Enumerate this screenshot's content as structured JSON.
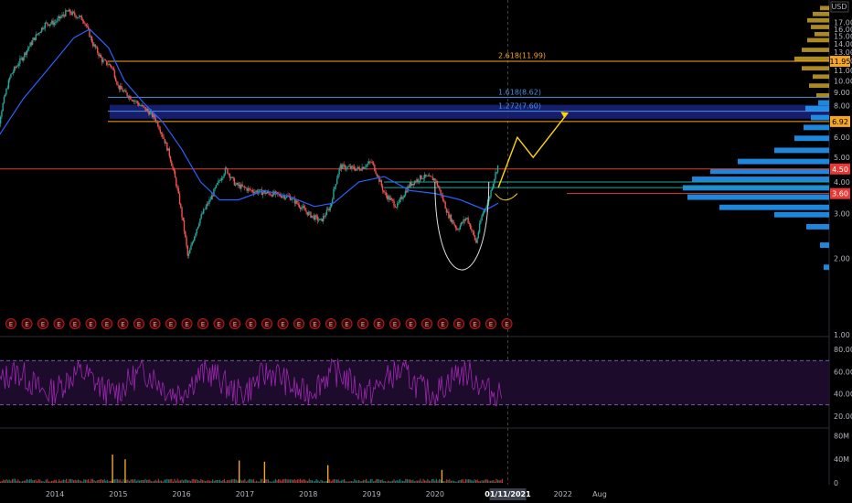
{
  "chart_data": {
    "type": "candlestick",
    "currency": "USD",
    "price_axis": {
      "scale": "log",
      "ticks": [
        "17.00",
        "16.00",
        "15.00",
        "14.00",
        "13.00",
        "12.00",
        "11.00",
        "10.00",
        "9.00",
        "8.00",
        "7.00",
        "6.00",
        "5.00",
        "4.00",
        "3.00",
        "2.00",
        "1.00"
      ]
    },
    "time_axis": {
      "labels": [
        "2014",
        "2015",
        "2016",
        "2017",
        "2018",
        "2019",
        "2020",
        "2021",
        "2022",
        "Aug"
      ],
      "highlight": "01/11/2021"
    },
    "price_series": [
      [
        2013.0,
        4.0
      ],
      [
        2013.15,
        7.5
      ],
      [
        2013.3,
        10.5
      ],
      [
        2013.5,
        12.5
      ],
      [
        2013.7,
        15.0
      ],
      [
        2013.85,
        16.8
      ],
      [
        2014.0,
        17.0
      ],
      [
        2014.2,
        18.8
      ],
      [
        2014.45,
        17.5
      ],
      [
        2014.6,
        14.0
      ],
      [
        2014.75,
        12.0
      ],
      [
        2014.9,
        11.4
      ],
      [
        2015.0,
        9.5
      ],
      [
        2015.1,
        9.0
      ],
      [
        2015.2,
        8.6
      ],
      [
        2015.35,
        8.0
      ],
      [
        2015.5,
        7.5
      ],
      [
        2015.6,
        7.0
      ],
      [
        2015.8,
        5.2
      ],
      [
        2016.0,
        3.0
      ],
      [
        2016.1,
        2.0
      ],
      [
        2016.3,
        2.9
      ],
      [
        2016.45,
        3.4
      ],
      [
        2016.7,
        4.5
      ],
      [
        2016.85,
        3.9
      ],
      [
        2017.1,
        3.7
      ],
      [
        2017.4,
        3.6
      ],
      [
        2017.7,
        3.5
      ],
      [
        2018.0,
        3.0
      ],
      [
        2018.2,
        2.8
      ],
      [
        2018.35,
        3.2
      ],
      [
        2018.5,
        4.6
      ],
      [
        2018.8,
        4.5
      ],
      [
        2019.0,
        4.8
      ],
      [
        2019.2,
        3.6
      ],
      [
        2019.4,
        3.2
      ],
      [
        2019.6,
        3.9
      ],
      [
        2019.8,
        4.2
      ],
      [
        2020.0,
        4.1
      ],
      [
        2020.2,
        3.0
      ],
      [
        2020.35,
        2.6
      ],
      [
        2020.5,
        2.9
      ],
      [
        2020.65,
        2.3
      ],
      [
        2020.75,
        3.0
      ],
      [
        2020.85,
        3.4
      ],
      [
        2021.0,
        4.7
      ]
    ],
    "moving_average": [
      [
        2013.0,
        5.5
      ],
      [
        2013.5,
        8.5
      ],
      [
        2014.0,
        12.0
      ],
      [
        2014.3,
        14.8
      ],
      [
        2014.55,
        16.0
      ],
      [
        2014.85,
        13.5
      ],
      [
        2015.1,
        10.0
      ],
      [
        2015.4,
        8.2
      ],
      [
        2015.7,
        6.9
      ],
      [
        2016.0,
        5.4
      ],
      [
        2016.3,
        4.0
      ],
      [
        2016.6,
        3.4
      ],
      [
        2016.9,
        3.4
      ],
      [
        2017.3,
        3.7
      ],
      [
        2017.7,
        3.5
      ],
      [
        2018.1,
        3.2
      ],
      [
        2018.4,
        3.3
      ],
      [
        2018.8,
        4.0
      ],
      [
        2019.2,
        4.2
      ],
      [
        2019.6,
        3.7
      ],
      [
        2020.0,
        3.6
      ],
      [
        2020.4,
        3.4
      ],
      [
        2020.8,
        3.1
      ],
      [
        2021.0,
        3.3
      ]
    ],
    "projection": [
      [
        2021.0,
        3.8
      ],
      [
        2021.3,
        6.0
      ],
      [
        2021.55,
        5.0
      ],
      [
        2022.1,
        7.5
      ]
    ],
    "rsi": {
      "ticks": [
        "80.00",
        "60.00",
        "40.00",
        "20.00"
      ],
      "overbought": 70,
      "oversold": 30
    },
    "volume": {
      "ticks": [
        "80M",
        "40M",
        "0"
      ],
      "spikes": [
        [
          2014.9,
          48
        ],
        [
          2015.1,
          40
        ],
        [
          2016.9,
          38
        ],
        [
          2017.3,
          36
        ],
        [
          2018.3,
          30
        ],
        [
          2020.1,
          22
        ]
      ]
    },
    "annotations": [
      {
        "label": "2.618(11.99)",
        "price": 11.99,
        "color": "#f5a623"
      },
      {
        "label": "1.618(8.62)",
        "price": 8.62,
        "color": "#4a90e2"
      },
      {
        "label": "1.272(7.60)",
        "price": 7.6,
        "color": "#4a90e2"
      }
    ],
    "price_tags": [
      {
        "label": "11.95",
        "price": 11.95,
        "bg": "#f5a623",
        "fg": "#000000"
      },
      {
        "label": "6.92",
        "price": 6.92,
        "bg": "#f5a623",
        "fg": "#000000"
      },
      {
        "label": "4.50",
        "price": 4.5,
        "bg": "#e53935",
        "fg": "#ffffff"
      },
      {
        "label": "3.60",
        "price": 3.6,
        "bg": "#e53935",
        "fg": "#ffffff"
      }
    ],
    "earnings_marker": "E",
    "colors": {
      "up": "#26a69a",
      "down": "#ef5350",
      "ma": "#2962ff",
      "rsi": "#9c27b0",
      "fib": "#f5a623",
      "zone": "#1a237e",
      "projection": "#ffd600",
      "profile": "#2196f3",
      "profile_hi": "#c9a227"
    }
  }
}
